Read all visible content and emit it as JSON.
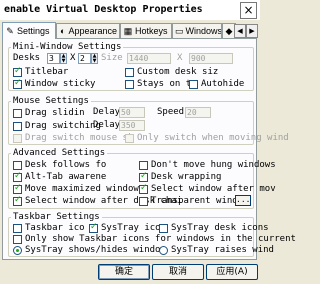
{
  "window": {
    "title": "enable Virtual Desktop Properties",
    "close_glyph": "×"
  },
  "tabs": [
    {
      "label": "Settings",
      "icon": "settings-icon"
    },
    {
      "label": "Appearance",
      "icon": "appearance-icon"
    },
    {
      "label": "Hotkeys",
      "icon": "keyboard-icon"
    },
    {
      "label": "Windows",
      "icon": "window-icon"
    }
  ],
  "mini": {
    "title": "Mini-Window Settings",
    "desks_label": "Desks",
    "desks_x": "3",
    "x_sep": "X",
    "desks_y": "2",
    "size_label": "Size",
    "size_w": "1440",
    "size_x": "X",
    "size_h": "900",
    "titlebar": "Titlebar",
    "custom_size": "Custom desk siz",
    "window_sticky": "Window sticky",
    "stays_on": "Stays on t",
    "autohide": "Autohide"
  },
  "mouse": {
    "title": "Mouse Settings",
    "drag_sliding": "Drag slidin",
    "delay1_label": "Delay",
    "delay1": "50",
    "speed_label": "Speed",
    "speed": "20",
    "drag_switching": "Drag switching",
    "delay2_label": "Delay",
    "delay2": "350",
    "drag_switch_mouse": "Drag switch mouse sk",
    "only_switch": "Only switch when moving wind"
  },
  "advanced": {
    "title": "Advanced Settings",
    "desk_follows": "Desk follows fo",
    "dont_move": "Don't move hung windows",
    "alt_tab": "Alt-Tab awarene",
    "desk_wrapping": "Desk wrapping",
    "move_maximized": "Move maximized windows",
    "select_after_move": "Select window after mov",
    "select_after_desk": "Select window after desk chai",
    "transparent": "Transparent windo",
    "dots": "..."
  },
  "taskbar": {
    "title": "Taskbar Settings",
    "taskbar_icon": "Taskbar ico",
    "systray_icon": "SysTray ico",
    "systray_desk": "SysTray desk icons",
    "only_show": "Only show Taskbar icons for windows in the current",
    "radio_shows": "SysTray shows/hides window",
    "radio_raises": "SysTray raises wind"
  },
  "footer": {
    "ok": "确定",
    "cancel": "取消",
    "apply": "应用(A)"
  }
}
